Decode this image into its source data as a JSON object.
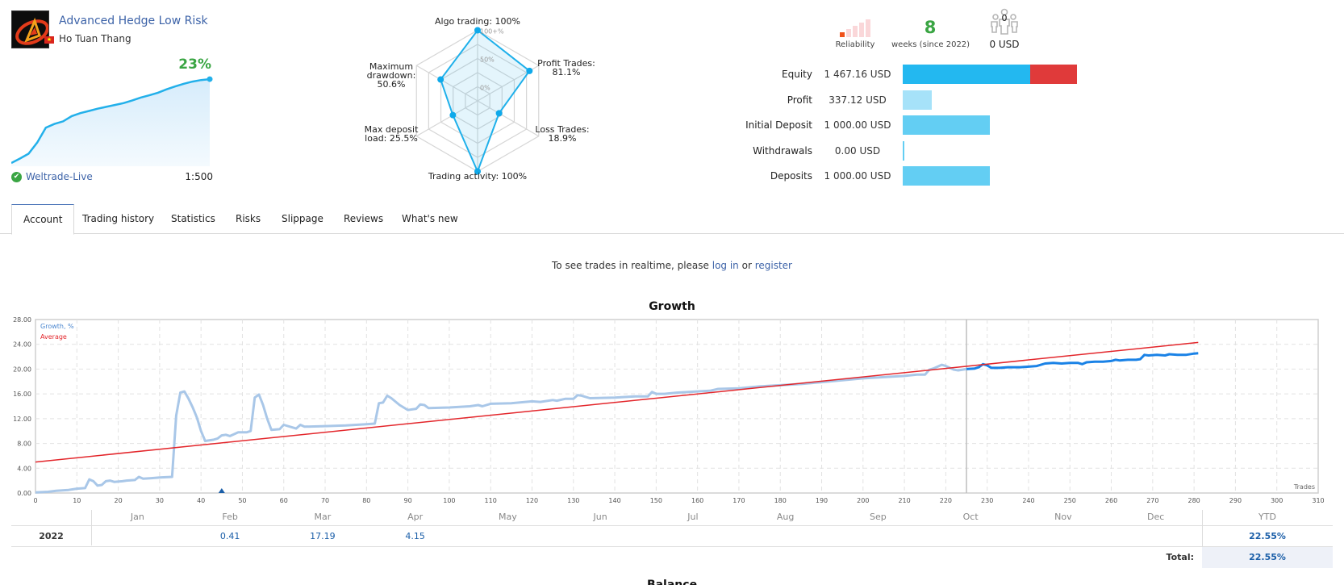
{
  "signal": {
    "title": "Advanced Hedge Low Risk",
    "author": "Ho Tuan Thang",
    "growth_pct": "23%",
    "broker": "Weltrade-Live",
    "leverage": "1:500",
    "mini_growth_curve": [
      0,
      1.2,
      2.5,
      5.5,
      9.5,
      10.5,
      11.2,
      12.6,
      13.4,
      14,
      14.6,
      15.1,
      15.6,
      16.1,
      16.8,
      17.6,
      18.2,
      18.9,
      19.8,
      20.6,
      21.3,
      21.9,
      22.3,
      22.55
    ]
  },
  "radar": {
    "axes": [
      {
        "label": "Algo trading: 100%",
        "value": 100
      },
      {
        "label": "Profit Trades:\n81.1%",
        "value": 81.1
      },
      {
        "label": "Loss Trades:\n18.9%",
        "value": 18.9
      },
      {
        "label": "Trading activity: 100%",
        "value": 100
      },
      {
        "label": "Max deposit\nload: 25.5%",
        "value": 25.5
      },
      {
        "label": "Maximum\ndrawdown:\n50.6%",
        "value": 50.6
      }
    ],
    "scale_labels": [
      "100+%",
      "50%",
      "0%"
    ]
  },
  "stats": {
    "reliability": {
      "label": "Reliability",
      "level": 1,
      "max": 5
    },
    "weeks": {
      "value": "8",
      "label": "weeks (since 2022)"
    },
    "subscribers": {
      "count": "0",
      "value": "0 USD"
    },
    "colors": {
      "accent_green": "#3aa543",
      "bar_blue": "#23b8f0",
      "bar_red": "#e03a3a",
      "bar_light": "#63cef3",
      "bar_pale": "#a6e2f9"
    }
  },
  "financials": [
    {
      "label": "Equity",
      "value": "1 467.16 USD",
      "amount": 1467.16,
      "drawdown_part": 530
    },
    {
      "label": "Profit",
      "value": "337.12 USD",
      "amount": 337.12
    },
    {
      "label": "Initial Deposit",
      "value": "1 000.00 USD",
      "amount": 1000
    },
    {
      "label": "Withdrawals",
      "value": "0.00 USD",
      "amount": 0
    },
    {
      "label": "Deposits",
      "value": "1 000.00 USD",
      "amount": 1000
    }
  ],
  "tabs": [
    {
      "label": "Account",
      "active": true
    },
    {
      "label": "Trading history"
    },
    {
      "label": "Statistics"
    },
    {
      "label": "Risks"
    },
    {
      "label": "Slippage"
    },
    {
      "label": "Reviews"
    },
    {
      "label": "What's new"
    }
  ],
  "login_msg": {
    "prefix": "To see trades in realtime, please ",
    "login": "log in",
    "middle": " or ",
    "register": "register"
  },
  "chart_data": {
    "type": "line",
    "title": "Growth",
    "xlabel": "Trades",
    "ylabel": "",
    "xlim": [
      0,
      310
    ],
    "ylim": [
      0,
      28
    ],
    "x_ticks": [
      0,
      10,
      20,
      30,
      40,
      50,
      60,
      70,
      80,
      90,
      100,
      110,
      120,
      130,
      140,
      150,
      160,
      170,
      180,
      190,
      200,
      210,
      220,
      230,
      240,
      250,
      260,
      270,
      280,
      290,
      300,
      310
    ],
    "y_ticks": [
      "0.00",
      "4.00",
      "8.00",
      "12.00",
      "16.00",
      "20.00",
      "24.00",
      "28.00"
    ],
    "grid": true,
    "legend": {
      "position": "top-left",
      "entries": [
        "Growth, %",
        "Average"
      ]
    },
    "divider_trade": 225,
    "marker_trade": 45,
    "series": [
      {
        "name": "Growth, %",
        "color_history": "#a9c7e8",
        "color_recent": "#1a82e6",
        "points": [
          [
            0,
            0.1
          ],
          [
            3,
            0.2
          ],
          [
            5,
            0.35
          ],
          [
            8,
            0.5
          ],
          [
            10,
            0.7
          ],
          [
            12,
            0.8
          ],
          [
            13,
            2.2
          ],
          [
            14,
            1.9
          ],
          [
            15,
            1.2
          ],
          [
            16,
            1.3
          ],
          [
            17,
            1.9
          ],
          [
            18,
            2.0
          ],
          [
            19,
            1.8
          ],
          [
            21,
            1.9
          ],
          [
            22,
            2.0
          ],
          [
            24,
            2.1
          ],
          [
            25,
            2.6
          ],
          [
            26,
            2.3
          ],
          [
            28,
            2.4
          ],
          [
            30,
            2.5
          ],
          [
            33,
            2.6
          ],
          [
            34,
            12.5
          ],
          [
            35,
            16.2
          ],
          [
            36,
            16.4
          ],
          [
            37,
            15.2
          ],
          [
            38,
            13.8
          ],
          [
            39,
            12.2
          ],
          [
            40,
            10.0
          ],
          [
            41,
            8.4
          ],
          [
            43,
            8.6
          ],
          [
            44,
            8.8
          ],
          [
            45,
            9.3
          ],
          [
            46,
            9.4
          ],
          [
            47,
            9.2
          ],
          [
            49,
            9.8
          ],
          [
            51,
            9.8
          ],
          [
            52,
            10.0
          ],
          [
            53,
            15.4
          ],
          [
            54,
            15.9
          ],
          [
            55,
            14.2
          ],
          [
            56,
            12.0
          ],
          [
            57,
            10.2
          ],
          [
            59,
            10.3
          ],
          [
            60,
            11.0
          ],
          [
            62,
            10.6
          ],
          [
            63,
            10.4
          ],
          [
            64,
            11.0
          ],
          [
            65,
            10.7
          ],
          [
            70,
            10.8
          ],
          [
            75,
            10.9
          ],
          [
            80,
            11.1
          ],
          [
            82,
            11.2
          ],
          [
            83,
            14.5
          ],
          [
            84,
            14.6
          ],
          [
            85,
            15.7
          ],
          [
            86,
            15.3
          ],
          [
            88,
            14.2
          ],
          [
            90,
            13.4
          ],
          [
            92,
            13.6
          ],
          [
            93,
            14.3
          ],
          [
            94,
            14.2
          ],
          [
            95,
            13.7
          ],
          [
            100,
            13.8
          ],
          [
            105,
            14.0
          ],
          [
            107,
            14.2
          ],
          [
            108,
            14.0
          ],
          [
            110,
            14.4
          ],
          [
            115,
            14.5
          ],
          [
            120,
            14.8
          ],
          [
            122,
            14.7
          ],
          [
            125,
            15.0
          ],
          [
            126,
            14.9
          ],
          [
            128,
            15.2
          ],
          [
            130,
            15.2
          ],
          [
            131,
            15.8
          ],
          [
            132,
            15.7
          ],
          [
            134,
            15.3
          ],
          [
            140,
            15.4
          ],
          [
            145,
            15.6
          ],
          [
            148,
            15.6
          ],
          [
            149,
            16.3
          ],
          [
            150,
            16.0
          ],
          [
            152,
            16.0
          ],
          [
            155,
            16.2
          ],
          [
            160,
            16.4
          ],
          [
            163,
            16.5
          ],
          [
            165,
            16.8
          ],
          [
            170,
            16.9
          ],
          [
            175,
            17.2
          ],
          [
            180,
            17.4
          ],
          [
            185,
            17.6
          ],
          [
            190,
            17.9
          ],
          [
            195,
            18.2
          ],
          [
            200,
            18.5
          ],
          [
            205,
            18.7
          ],
          [
            210,
            18.9
          ],
          [
            213,
            19.1
          ],
          [
            215,
            19.1
          ],
          [
            216,
            19.9
          ],
          [
            217,
            20.1
          ],
          [
            219,
            20.7
          ],
          [
            220,
            20.5
          ],
          [
            222,
            19.9
          ],
          [
            223,
            19.8
          ],
          [
            225,
            20.0
          ]
        ]
      },
      {
        "name": "Growth, % (recent)",
        "points": [
          [
            225,
            20.0
          ],
          [
            227,
            20.1
          ],
          [
            228,
            20.3
          ],
          [
            229,
            20.8
          ],
          [
            230,
            20.6
          ],
          [
            231,
            20.2
          ],
          [
            233,
            20.2
          ],
          [
            235,
            20.3
          ],
          [
            238,
            20.3
          ],
          [
            240,
            20.4
          ],
          [
            242,
            20.5
          ],
          [
            244,
            20.9
          ],
          [
            246,
            21.0
          ],
          [
            248,
            20.9
          ],
          [
            250,
            21.0
          ],
          [
            252,
            21.0
          ],
          [
            253,
            20.8
          ],
          [
            254,
            21.1
          ],
          [
            256,
            21.2
          ],
          [
            258,
            21.2
          ],
          [
            260,
            21.3
          ],
          [
            261,
            21.5
          ],
          [
            262,
            21.4
          ],
          [
            264,
            21.5
          ],
          [
            266,
            21.5
          ],
          [
            267,
            21.6
          ],
          [
            268,
            22.3
          ],
          [
            269,
            22.2
          ],
          [
            271,
            22.3
          ],
          [
            273,
            22.2
          ],
          [
            274,
            22.4
          ],
          [
            276,
            22.3
          ],
          [
            278,
            22.3
          ],
          [
            280,
            22.5
          ],
          [
            281,
            22.55
          ]
        ]
      },
      {
        "name": "Average",
        "color": "#e3262b",
        "points": [
          [
            0,
            5.0
          ],
          [
            281,
            24.3
          ]
        ]
      }
    ]
  },
  "monthly": {
    "months": [
      "Jan",
      "Feb",
      "Mar",
      "Apr",
      "May",
      "Jun",
      "Jul",
      "Aug",
      "Sep",
      "Oct",
      "Nov",
      "Dec"
    ],
    "ytd_label": "YTD",
    "rows": [
      {
        "year": "2022",
        "values": [
          "",
          "0.41",
          "17.19",
          "4.15",
          "",
          "",
          "",
          "",
          "",
          "",
          "",
          ""
        ],
        "ytd": "22.55%"
      }
    ],
    "total_label": "Total:",
    "total": "22.55%"
  },
  "next_heading": "Balance"
}
